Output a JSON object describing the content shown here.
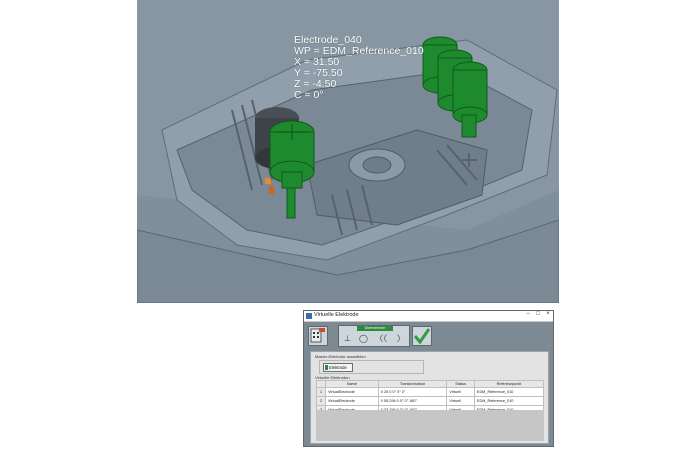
{
  "viewport": {
    "overlay_lines": [
      "Electrode_040",
      "WP = EDM_Reference_010",
      "X = 31.50",
      "Y = -75.50",
      "Z = -4.50",
      "C = 0°"
    ]
  },
  "dialog": {
    "title": "Virtuelle Elektrode",
    "window_buttons": [
      "−",
      "□",
      "×"
    ],
    "toolbar": {
      "nav_label": "Übernehmen",
      "nav_symbols": [
        "⊥",
        "◯",
        "〈〈",
        "〉"
      ]
    },
    "master_section": "Master-Elektrode auswählen",
    "electrode_button": "Elektrode",
    "virtual_section": "Virtuelle Elektroden",
    "table": {
      "columns": [
        "Name",
        "Transformation",
        "Status",
        "Referenzpunkt"
      ],
      "rows": [
        {
          "index": "1",
          "name": "VirtualElectrode",
          "transformation": "0 25 0 0° 0° 0°",
          "status": "Virtuell",
          "reference": "EDM_Reference_010"
        },
        {
          "index": "2",
          "name": "VirtualElectrode",
          "transformation": "0 55.296 0 0° 0° 180°",
          "status": "Virtuell",
          "reference": "EDM_Reference_010"
        },
        {
          "index": "3",
          "name": "VirtualElectrode",
          "transformation": "0 33.296 0 0° 0° 180°",
          "status": "Virtuell",
          "reference": "EDM_Reference_010"
        }
      ]
    }
  },
  "colors": {
    "model_gray": "#7d8d99",
    "electrode_green": "#1e8a2e",
    "accent_green": "#2e8b3b"
  }
}
